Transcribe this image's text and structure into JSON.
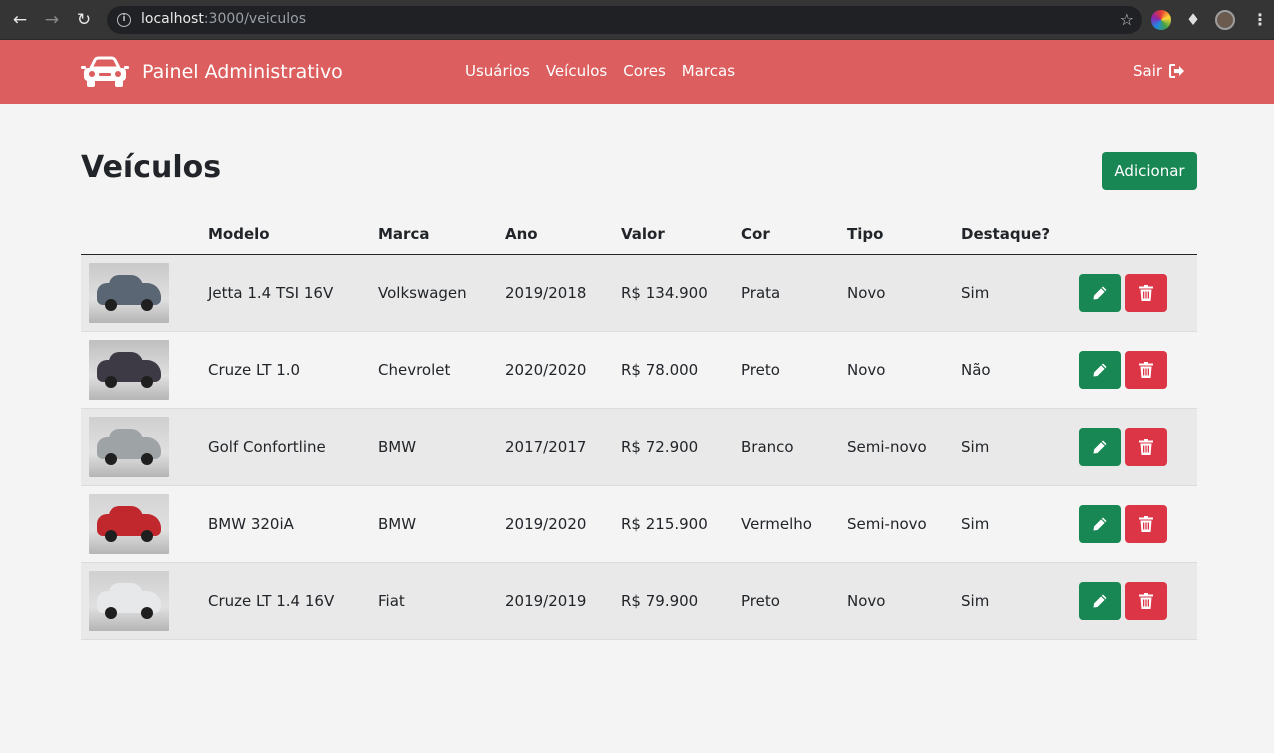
{
  "browser": {
    "url_host": "localhost",
    "url_path": ":3000/veiculos"
  },
  "navbar": {
    "brand": "Painel Administrativo",
    "links": [
      "Usuários",
      "Veículos",
      "Cores",
      "Marcas"
    ],
    "logout": "Sair",
    "color": "#dc5e5e"
  },
  "page": {
    "title": "Veículos",
    "add_button": "Adicionar"
  },
  "table": {
    "headers": [
      "",
      "Modelo",
      "Marca",
      "Ano",
      "Valor",
      "Cor",
      "Tipo",
      "Destaque?",
      ""
    ],
    "rows": [
      {
        "modelo": "Jetta 1.4 TSI 16V",
        "marca": "Volkswagen",
        "ano": "2019/2018",
        "valor": "R$ 134.900",
        "cor": "Prata",
        "tipo": "Novo",
        "destaque": "Sim",
        "thumb_bg": "#c9c9c9",
        "car_color": "#5a6673"
      },
      {
        "modelo": "Cruze LT 1.0",
        "marca": "Chevrolet",
        "ano": "2020/2020",
        "valor": "R$ 78.000",
        "cor": "Preto",
        "tipo": "Novo",
        "destaque": "Não",
        "thumb_bg": "#bfbfbf",
        "car_color": "#3e3a45"
      },
      {
        "modelo": "Golf Confortline",
        "marca": "BMW",
        "ano": "2017/2017",
        "valor": "R$ 72.900",
        "cor": "Branco",
        "tipo": "Semi-novo",
        "destaque": "Sim",
        "thumb_bg": "#cfcfcf",
        "car_color": "#9ea3a6"
      },
      {
        "modelo": "BMW 320iA",
        "marca": "BMW",
        "ano": "2019/2020",
        "valor": "R$ 215.900",
        "cor": "Vermelho",
        "tipo": "Semi-novo",
        "destaque": "Sim",
        "thumb_bg": "#d4d4d4",
        "car_color": "#c0282e"
      },
      {
        "modelo": "Cruze LT 1.4 16V",
        "marca": "Fiat",
        "ano": "2019/2019",
        "valor": "R$ 79.900",
        "cor": "Preto",
        "tipo": "Novo",
        "destaque": "Sim",
        "thumb_bg": "#cfcfcf",
        "car_color": "#e6e8ea"
      }
    ]
  }
}
